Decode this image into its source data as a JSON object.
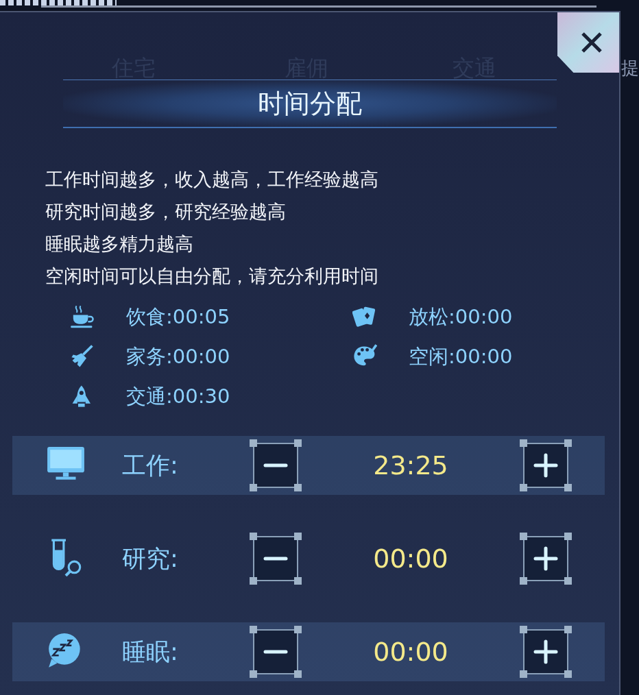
{
  "background_tabs": [
    {
      "label": "住宅"
    },
    {
      "label": "雇佣"
    },
    {
      "label": "交通"
    },
    {
      "label": "提"
    }
  ],
  "dialog": {
    "title": "时间分配",
    "description": [
      "工作时间越多，收入越高，工作经验越高",
      "研究时间越多，研究经验越高",
      "睡眠越多精力越高",
      "空闲时间可以自由分配，请充分利用时间"
    ],
    "fixed_activities": [
      {
        "kind": "meal",
        "label": "饮食:00:05"
      },
      {
        "kind": "leisure",
        "label": "放松:00:00"
      },
      {
        "kind": "housework",
        "label": "家务:00:00"
      },
      {
        "kind": "free",
        "label": "空闲:00:00"
      },
      {
        "kind": "transport",
        "label": "交通:00:30"
      }
    ],
    "allocations": [
      {
        "kind": "work",
        "label": "工作:",
        "value": "23:25",
        "highlighted": true
      },
      {
        "kind": "research",
        "label": "研究:",
        "value": "00:00",
        "highlighted": false
      },
      {
        "kind": "sleep",
        "label": "睡眠:",
        "value": "00:00",
        "highlighted": true
      }
    ]
  }
}
